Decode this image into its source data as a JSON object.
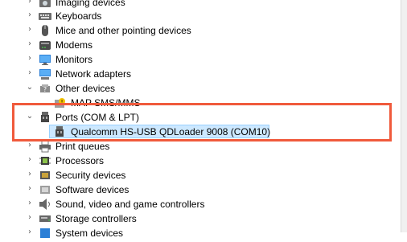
{
  "tree": {
    "items": [
      {
        "label": "Imaging devices",
        "icon": "camera-icon",
        "expanded": false
      },
      {
        "label": "Keyboards",
        "icon": "keyboard-icon",
        "expanded": false
      },
      {
        "label": "Mice and other pointing devices",
        "icon": "mouse-icon",
        "expanded": false
      },
      {
        "label": "Modems",
        "icon": "modem-icon",
        "expanded": false
      },
      {
        "label": "Monitors",
        "icon": "monitor-icon",
        "expanded": false
      },
      {
        "label": "Network adapters",
        "icon": "network-adapter-icon",
        "expanded": false
      },
      {
        "label": "Other devices",
        "icon": "unknown-device-icon",
        "expanded": true
      },
      {
        "label": "MAP SMS/MMS",
        "icon": "warning-device-icon",
        "child": true
      },
      {
        "label": "Ports (COM & LPT)",
        "icon": "port-icon",
        "expanded": true
      },
      {
        "label": "Qualcomm HS-USB QDLoader 9008 (COM10)",
        "icon": "port-icon",
        "child": true,
        "selected": true
      },
      {
        "label": "Print queues",
        "icon": "printer-icon",
        "expanded": false
      },
      {
        "label": "Processors",
        "icon": "processor-icon",
        "expanded": false
      },
      {
        "label": "Security devices",
        "icon": "security-device-icon",
        "expanded": false
      },
      {
        "label": "Software devices",
        "icon": "software-device-icon",
        "expanded": false
      },
      {
        "label": "Sound, video and game controllers",
        "icon": "speaker-icon",
        "expanded": false
      },
      {
        "label": "Storage controllers",
        "icon": "storage-controller-icon",
        "expanded": false
      },
      {
        "label": "System devices",
        "icon": "system-device-icon",
        "expanded": false
      }
    ]
  },
  "colors": {
    "selection_bg": "#cce8ff",
    "selection_border": "#99d1ff",
    "highlight_box": "#f05a3c"
  }
}
